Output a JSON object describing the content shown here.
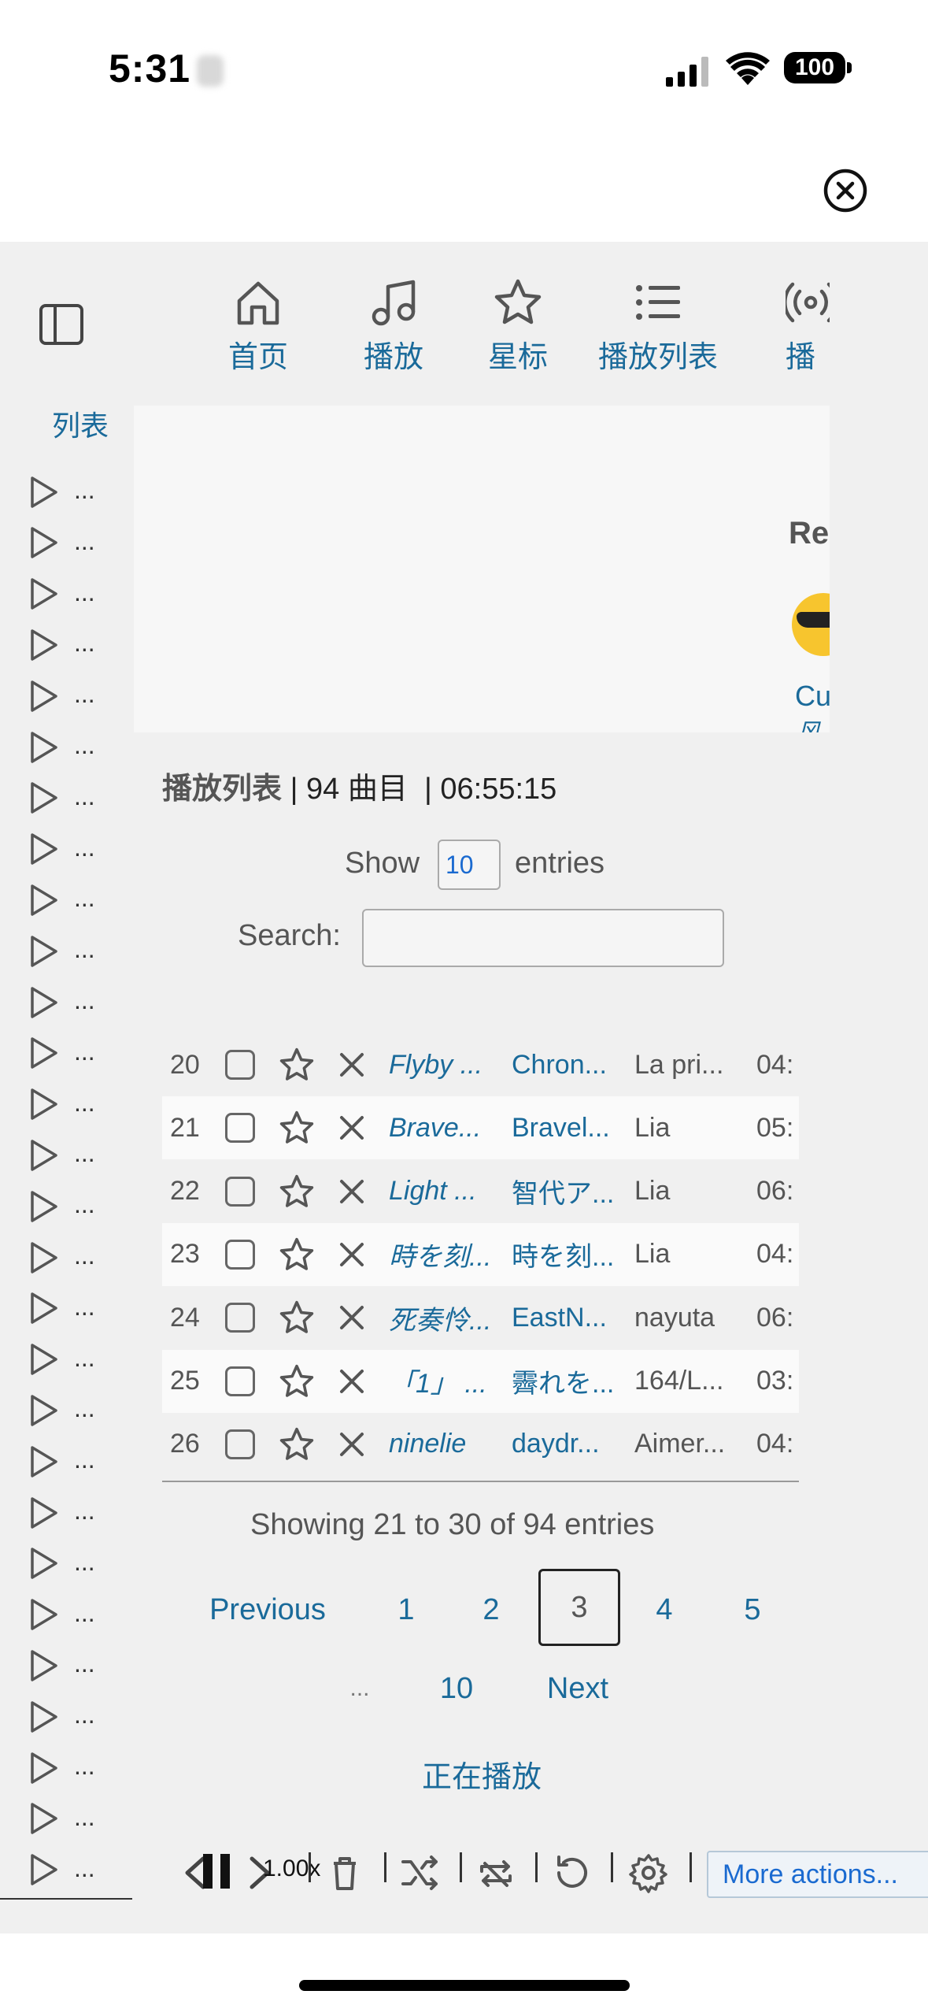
{
  "status_bar": {
    "time": "5:31",
    "battery": "100"
  },
  "nav": {
    "items": [
      {
        "label": "首页",
        "icon": "home-icon"
      },
      {
        "label": "播放",
        "icon": "music-note-icon"
      },
      {
        "label": "星标",
        "icon": "star-icon"
      },
      {
        "label": "播放列表",
        "icon": "list-icon"
      },
      {
        "label": "播客",
        "icon": "podcast-icon"
      }
    ]
  },
  "sidebar": {
    "title": "列表",
    "item_text": "..."
  },
  "banner": {
    "heading": "Re",
    "link": "Cu",
    "sub": "风"
  },
  "playlist": {
    "title": "播放列表",
    "count": "| 94 曲目",
    "duration": "| 06:55:15",
    "show_label": "Show",
    "show_value": "10",
    "entries_label": "entries",
    "search_label": "Search:",
    "rows": [
      {
        "num": "20",
        "title": "Flyby ...",
        "album": "Chron...",
        "artist": "La pri...",
        "duration": "04:"
      },
      {
        "num": "21",
        "title": "Brave...",
        "album": "Bravel...",
        "artist": "Lia",
        "duration": "05:"
      },
      {
        "num": "22",
        "title": "Light ...",
        "album": "智代ア...",
        "artist": "Lia",
        "duration": "06:"
      },
      {
        "num": "23",
        "title": "時を刻...",
        "album": "時を刻...",
        "artist": "Lia",
        "duration": "04:"
      },
      {
        "num": "24",
        "title": "死奏怜...",
        "album": "EastN...",
        "artist": "nayuta",
        "duration": "06:"
      },
      {
        "num": "25",
        "title": "「1」 ...",
        "album": "霽れを...",
        "artist": "164/L...",
        "duration": "03:"
      },
      {
        "num": "26",
        "title": "ninelie",
        "album": "daydr...",
        "artist": "Aimer...",
        "duration": "04:"
      }
    ],
    "info": "Showing 21 to 30 of 94 entries",
    "pagination": {
      "previous": "Previous",
      "p1": "1",
      "p2": "2",
      "p3": "3",
      "p4": "4",
      "p5": "5",
      "ellipsis": "...",
      "p10": "10",
      "next": "Next",
      "current": "3"
    },
    "now_playing": "正在播放"
  },
  "player": {
    "speed": "1.00x",
    "more_actions": "More actions..."
  },
  "colors": {
    "accent": "#1a6a9a",
    "app_bg": "#f0f0f0",
    "link_blue": "#1a6ad0"
  }
}
